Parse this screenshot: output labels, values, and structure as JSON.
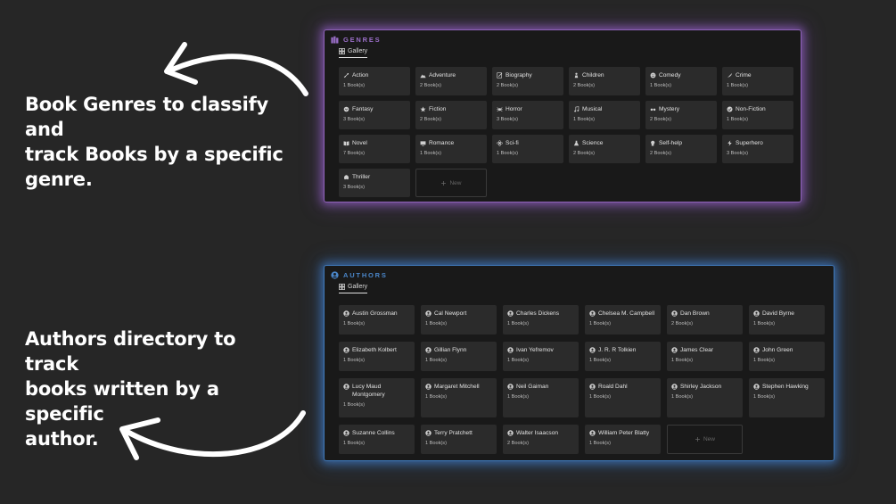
{
  "captions": {
    "genres": [
      "Book Genres to classify and",
      "track Books by a specific",
      "genre."
    ],
    "authors": [
      "Authors directory to track",
      "books written by a specific",
      "author."
    ]
  },
  "colors": {
    "genres_accent": "#9b6fc9",
    "authors_accent": "#4a86c9",
    "background": "#262626",
    "panel": "#191919",
    "card": "#2b2b2b"
  },
  "genres": {
    "title": "GENRES",
    "tab_label": "Gallery",
    "new_label": "New",
    "items": [
      {
        "name": "Action",
        "count": "1 Book(s)",
        "icon": "sword-icon"
      },
      {
        "name": "Adventure",
        "count": "2 Book(s)",
        "icon": "mountain-icon"
      },
      {
        "name": "Biography",
        "count": "2 Book(s)",
        "icon": "pencil-icon"
      },
      {
        "name": "Children",
        "count": "2 Book(s)",
        "icon": "child-icon"
      },
      {
        "name": "Comedy",
        "count": "1 Book(s)",
        "icon": "smile-icon"
      },
      {
        "name": "Crime",
        "count": "1 Book(s)",
        "icon": "knife-icon"
      },
      {
        "name": "Fantasy",
        "count": "3 Book(s)",
        "icon": "dragon-icon"
      },
      {
        "name": "Fiction",
        "count": "2 Book(s)",
        "icon": "star-icon"
      },
      {
        "name": "Horror",
        "count": "3 Book(s)",
        "icon": "spider-icon"
      },
      {
        "name": "Musical",
        "count": "1 Book(s)",
        "icon": "music-note-icon"
      },
      {
        "name": "Mystery",
        "count": "2 Book(s)",
        "icon": "glasses-icon"
      },
      {
        "name": "Non-Fiction",
        "count": "1 Book(s)",
        "icon": "check-circle-icon"
      },
      {
        "name": "Novel",
        "count": "7 Book(s)",
        "icon": "book-icon"
      },
      {
        "name": "Romance",
        "count": "1 Book(s)",
        "icon": "tv-icon"
      },
      {
        "name": "Sci-fi",
        "count": "1 Book(s)",
        "icon": "atom-icon"
      },
      {
        "name": "Science",
        "count": "2 Book(s)",
        "icon": "flask-icon"
      },
      {
        "name": "Self-help",
        "count": "2 Book(s)",
        "icon": "head-icon"
      },
      {
        "name": "Superhero",
        "count": "3 Book(s)",
        "icon": "lightning-icon"
      },
      {
        "name": "Thriller",
        "count": "3 Book(s)",
        "icon": "ghost-icon"
      }
    ]
  },
  "authors": {
    "title": "AUTHORS",
    "tab_label": "Gallery",
    "new_label": "New",
    "items": [
      {
        "name": "Austin Grossman",
        "count": "1 Book(s)"
      },
      {
        "name": "Cal Newport",
        "count": "1 Book(s)"
      },
      {
        "name": "Charles Dickens",
        "count": "1 Book(s)"
      },
      {
        "name": "Chelsea M. Campbell",
        "count": "1 Book(s)"
      },
      {
        "name": "Dan Brown",
        "count": "2 Book(s)"
      },
      {
        "name": "David Byrne",
        "count": "1 Book(s)"
      },
      {
        "name": "Elizabeth Kolbert",
        "count": "1 Book(s)"
      },
      {
        "name": "Gillian Flynn",
        "count": "1 Book(s)"
      },
      {
        "name": "Ivan Yefremov",
        "count": "1 Book(s)"
      },
      {
        "name": "J. R. R Tolkien",
        "count": "1 Book(s)"
      },
      {
        "name": "James Clear",
        "count": "1 Book(s)"
      },
      {
        "name": "John Green",
        "count": "1 Book(s)"
      },
      {
        "name": "Lucy Maud Montgomery",
        "count": "1 Book(s)"
      },
      {
        "name": "Margaret Mitchell",
        "count": "1 Book(s)"
      },
      {
        "name": "Neil Gaiman",
        "count": "1 Book(s)"
      },
      {
        "name": "Roald Dahl",
        "count": "1 Book(s)"
      },
      {
        "name": "Shirley Jackson",
        "count": "1 Book(s)"
      },
      {
        "name": "Stephen Hawking",
        "count": "1 Book(s)"
      },
      {
        "name": "Suzanne Collins",
        "count": "1 Book(s)"
      },
      {
        "name": "Terry Pratchett",
        "count": "1 Book(s)"
      },
      {
        "name": "Walter Isaacson",
        "count": "2 Book(s)"
      },
      {
        "name": "William Peter Blatty",
        "count": "1 Book(s)"
      }
    ]
  }
}
